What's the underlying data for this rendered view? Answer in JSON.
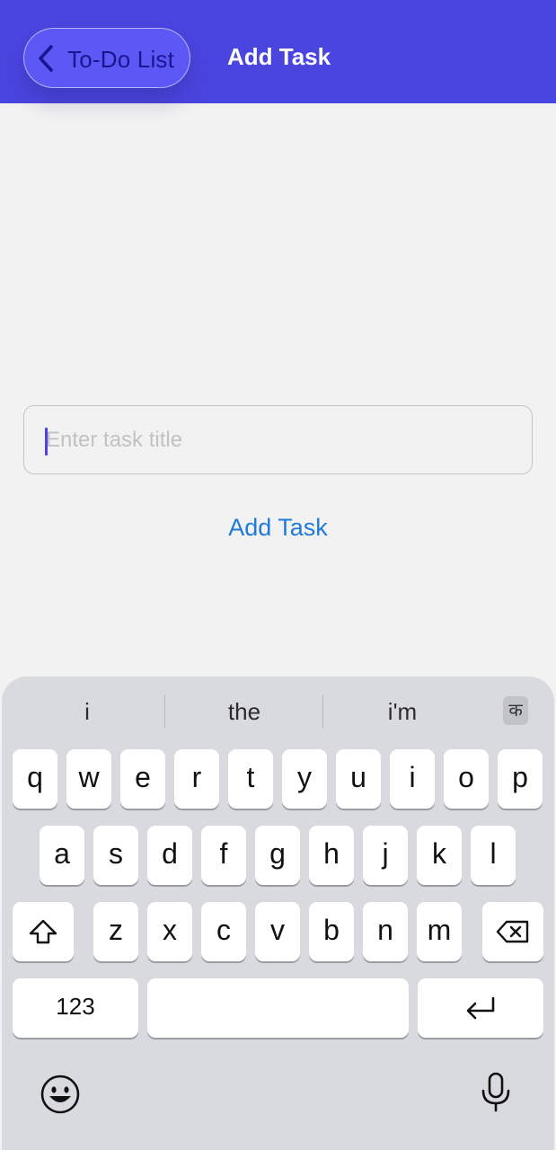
{
  "header": {
    "back_label": "To-Do List",
    "title": "Add Task"
  },
  "form": {
    "task_title_placeholder": "Enter task title",
    "task_title_value": "",
    "add_button_label": "Add Task"
  },
  "keyboard": {
    "suggestions": [
      "i",
      "the",
      "i'm"
    ],
    "language_label": "क",
    "row1": [
      "q",
      "w",
      "e",
      "r",
      "t",
      "y",
      "u",
      "i",
      "o",
      "p"
    ],
    "row2": [
      "a",
      "s",
      "d",
      "f",
      "g",
      "h",
      "j",
      "k",
      "l"
    ],
    "row3": [
      "z",
      "x",
      "c",
      "v",
      "b",
      "n",
      "m"
    ],
    "numbers_label": "123",
    "icons": {
      "shift": "shift-icon",
      "backspace": "backspace-icon",
      "return": "return-icon",
      "emoji": "emoji-icon",
      "mic": "microphone-icon"
    }
  },
  "colors": {
    "header_bg": "#4b45e0",
    "back_pill_bg": "#5c58f5",
    "link_blue": "#1f7ad9",
    "keyboard_bg": "#d9dadf"
  }
}
